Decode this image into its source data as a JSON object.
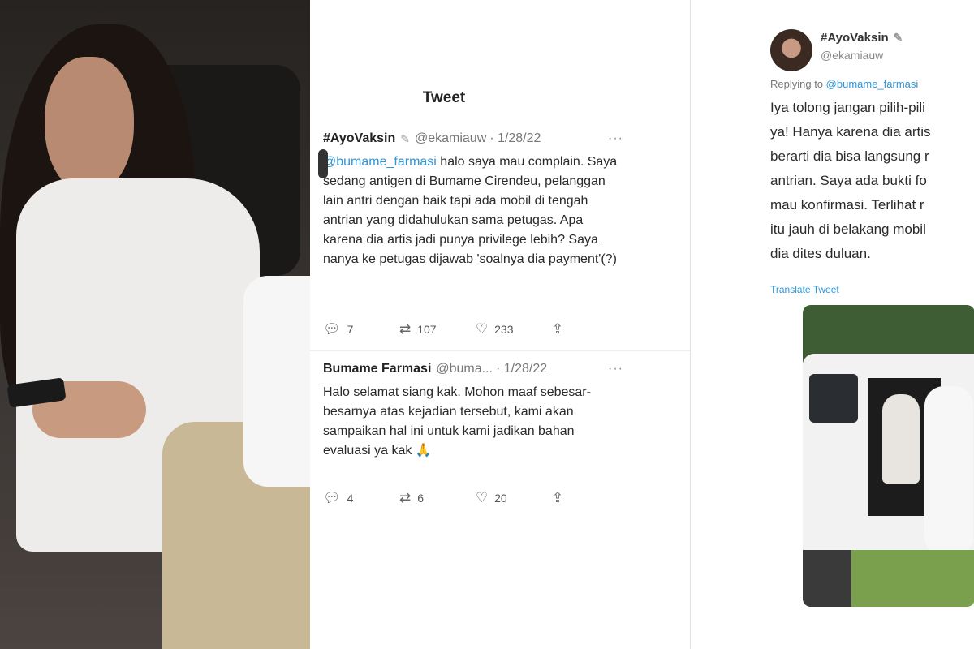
{
  "middle": {
    "page_title": "Tweet",
    "tweet1": {
      "name": "#AyoVaksin",
      "handle": "@ekamiauw",
      "date": "· 1/28/22",
      "more": "···",
      "mention": "@bumame_farmasi",
      "text_after_mention": " halo saya mau complain. Saya sedang antigen di Bumame Cirendeu, pelanggan lain antri dengan baik tapi ada mobil di tengah antrian yang didahulukan sama petugas. Apa karena dia artis jadi punya privilege lebih? Saya nanya ke petugas dijawab 'soalnya dia payment'(?)",
      "replies": "7",
      "retweets": "107",
      "likes": "233"
    },
    "tweet2": {
      "name": "Bumame Farmasi",
      "handle": "@buma...",
      "date": "· 1/28/22",
      "more": "···",
      "text": "Halo selamat siang kak. Mohon maaf sebesar-besarnya atas kejadian tersebut, kami akan sampaikan hal ini untuk kami jadikan bahan evaluasi ya kak 🙏",
      "replies": "4",
      "retweets": "6",
      "likes": "20"
    }
  },
  "right": {
    "name": "#AyoVaksin",
    "handle": "@ekamiauw",
    "replying_prefix": "Replying to ",
    "replying_mention": "@bumame_farmasi",
    "body_lines": [
      "Iya tolong jangan pilih-pili",
      "ya! Hanya karena dia artis",
      "berarti dia bisa langsung r",
      "antrian. Saya ada bukti fo",
      "mau konfirmasi. Terlihat r",
      "itu jauh di belakang mobil",
      "dia dites duluan."
    ],
    "translate_label": "Translate Tweet"
  },
  "icons": {
    "reply": "reply-icon",
    "retweet": "retweet-icon",
    "like": "heart-icon",
    "share": "share-icon"
  },
  "colors": {
    "link": "#2e95d8"
  }
}
